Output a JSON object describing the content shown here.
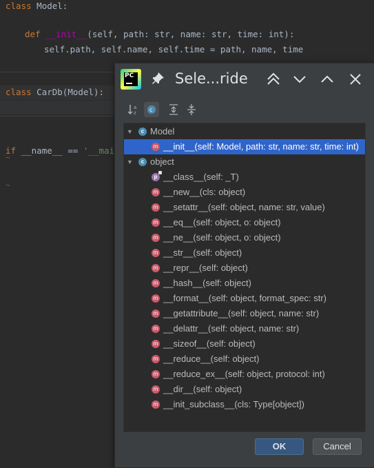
{
  "editor": {
    "lines": [
      {
        "k": "class",
        "rest": " Model:"
      },
      {
        "def": "def",
        "name": "__init__",
        "args": "(self, path: str, name: str, time: int):"
      },
      {
        "body": "self.path, self.name, self.time = path, name, time"
      },
      {
        "k": "class",
        "rest": " CarDb(Model):"
      },
      {
        "if": "if",
        "mid": " __name__ == ",
        "str": "'__main_"
      }
    ]
  },
  "dialog": {
    "title": "Sele...ride",
    "logo_text": "PC",
    "toolbar": [
      "sort-alpha-icon",
      "show-classes-icon",
      "expand-all-icon",
      "collapse-all-icon"
    ],
    "tree": [
      {
        "type": "class",
        "label": "Model",
        "expanded": true
      },
      {
        "type": "method",
        "label": "__init__(self: Model, path: str, name: str, time: int)",
        "selected": true
      },
      {
        "type": "class",
        "label": "object",
        "expanded": true
      },
      {
        "type": "property",
        "label": "__class__(self: _T)"
      },
      {
        "type": "method",
        "label": "__new__(cls: object)"
      },
      {
        "type": "method",
        "label": "__setattr__(self: object, name: str, value)"
      },
      {
        "type": "method",
        "label": "__eq__(self: object, o: object)"
      },
      {
        "type": "method",
        "label": "__ne__(self: object, o: object)"
      },
      {
        "type": "method",
        "label": "__str__(self: object)"
      },
      {
        "type": "method",
        "label": "__repr__(self: object)"
      },
      {
        "type": "method",
        "label": "__hash__(self: object)"
      },
      {
        "type": "method",
        "label": "__format__(self: object, format_spec: str)"
      },
      {
        "type": "method",
        "label": "__getattribute__(self: object, name: str)"
      },
      {
        "type": "method",
        "label": "__delattr__(self: object, name: str)"
      },
      {
        "type": "method",
        "label": "__sizeof__(self: object)"
      },
      {
        "type": "method",
        "label": "__reduce__(self: object)"
      },
      {
        "type": "method",
        "label": "__reduce_ex__(self: object, protocol: int)"
      },
      {
        "type": "method",
        "label": "__dir__(self: object)"
      },
      {
        "type": "method",
        "label": "__init_subclass__(cls: Type[object])"
      }
    ],
    "ok_label": "OK",
    "cancel_label": "Cancel"
  },
  "colors": {
    "selection": "#2f65ca",
    "ok_button": "#365880",
    "class_icon": "#4c8fb3",
    "method_icon": "#c75b6b"
  }
}
